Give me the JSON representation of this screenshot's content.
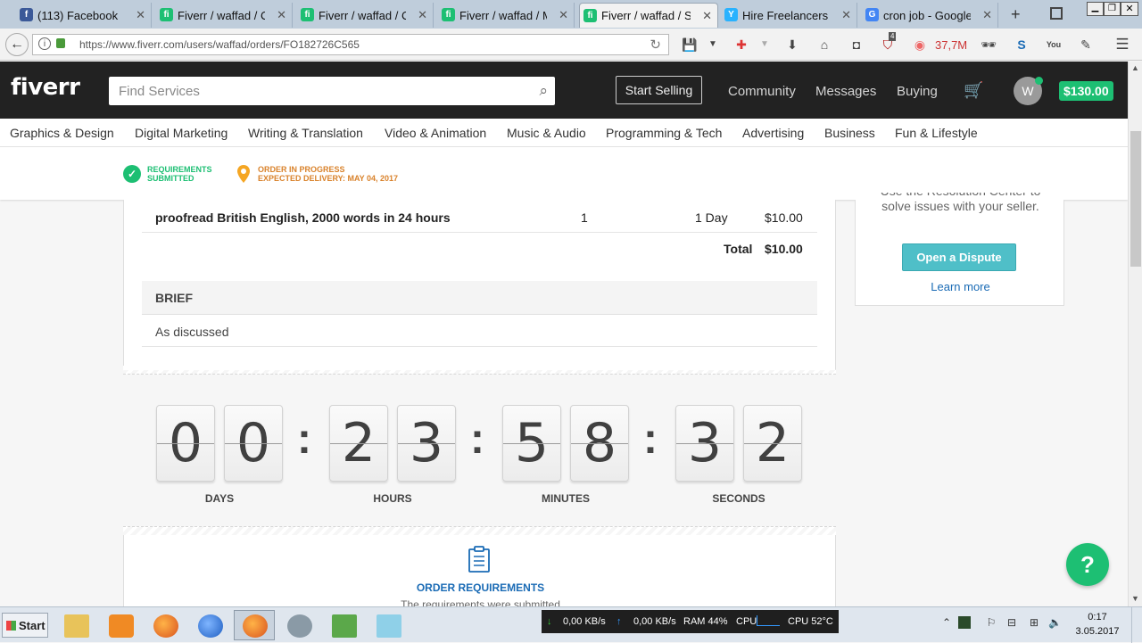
{
  "browser": {
    "tabs": [
      {
        "label": "(113) Facebook",
        "icon": "facebook-icon",
        "icon_color": "#3b5998",
        "icon_text": "f"
      },
      {
        "label": "Fiverr / waffad / Co",
        "icon": "fiverr-icon",
        "icon_color": "#1dbf73",
        "icon_text": "fi"
      },
      {
        "label": "Fiverr / waffad / Co",
        "icon": "fiverr-icon",
        "icon_color": "#1dbf73",
        "icon_text": "fi"
      },
      {
        "label": "Fiverr / waffad / My",
        "icon": "fiverr-icon",
        "icon_color": "#1dbf73",
        "icon_text": "fi"
      },
      {
        "label": "Fiverr / waffad / Sh",
        "icon": "fiverr-icon",
        "icon_color": "#1dbf73",
        "icon_text": "fi",
        "active": true
      },
      {
        "label": "Hire Freelancers & I",
        "icon": "freelancer-icon",
        "icon_color": "#29b2fe",
        "icon_text": "Y"
      },
      {
        "label": "cron job - Google S",
        "icon": "google-icon",
        "icon_color": "#4285f4",
        "icon_text": "G"
      }
    ],
    "url": "https://www.fiverr.com/users/waffad/orders/FO182726C565",
    "addon_count": "4",
    "memory_label": "37,7M"
  },
  "header": {
    "logo": "fiverr",
    "search_placeholder": "Find Services",
    "start_selling": "Start Selling",
    "links": [
      "Community",
      "Messages",
      "Buying"
    ],
    "avatar_initial": "W",
    "balance": "$130.00",
    "accent": "#1dbf73"
  },
  "categories": [
    "Graphics & Design",
    "Digital Marketing",
    "Writing & Translation",
    "Video & Animation",
    "Music & Audio",
    "Programming & Tech",
    "Advertising",
    "Business",
    "Fun & Lifestyle"
  ],
  "status": {
    "step1_line1": "REQUIREMENTS",
    "step1_line2": "SUBMITTED",
    "step2_line1": "ORDER IN PROGRESS",
    "step2_line2": "EXPECTED DELIVERY: MAY 04, 2017",
    "orange": "#d9822b"
  },
  "order": {
    "item_title": "proofread British English, 2000 words in 24 hours",
    "item_qty": "1",
    "item_duration": "1 Day",
    "item_price": "$10.00",
    "total_label": "Total",
    "total_value": "$10.00",
    "brief_label": "BRIEF",
    "brief_text": "As discussed"
  },
  "resolution": {
    "text": "Use the Resolution Center to solve issues with your seller.",
    "dispute_button": "Open a Dispute",
    "learn_more": "Learn more"
  },
  "countdown": {
    "days": [
      "0",
      "0"
    ],
    "hours": [
      "2",
      "3"
    ],
    "minutes": [
      "5",
      "8"
    ],
    "seconds": [
      "3",
      "2"
    ],
    "units": [
      "DAYS",
      "HOURS",
      "MINUTES",
      "SECONDS"
    ],
    "separator": ":"
  },
  "requirements": {
    "title": "ORDER REQUIREMENTS",
    "subtitle": "The requirements were submitted"
  },
  "help_label": "?",
  "taskbar": {
    "start": "Start",
    "net_down": "0,00 KB/s",
    "net_up": "0,00 KB/s",
    "ram": "RAM 44%",
    "cpu": "CPU",
    "cpu_temp": "CPU 52°C",
    "time": "0:17",
    "date": "3.05.2017"
  }
}
